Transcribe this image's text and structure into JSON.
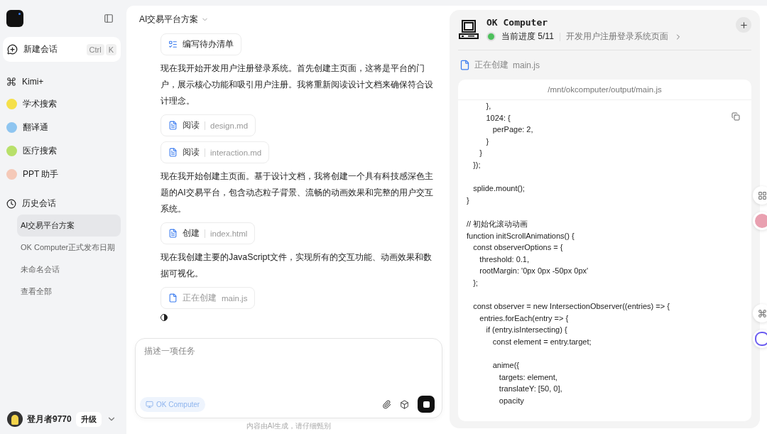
{
  "sidebar": {
    "new_chat": {
      "label": "新建会话",
      "keys": [
        "Ctrl",
        "K"
      ]
    },
    "items": [
      {
        "label": "Kimi+",
        "kind": "plain"
      },
      {
        "label": "学术搜索",
        "kind": "app",
        "color": "#f5e04a"
      },
      {
        "label": "翻译通",
        "kind": "app",
        "color": "#8ec5f0"
      },
      {
        "label": "医疗搜索",
        "kind": "app",
        "color": "#b8e06a"
      },
      {
        "label": "PPT 助手",
        "kind": "app",
        "color": "#f5c9b8"
      }
    ],
    "history": {
      "label": "历史会话",
      "items": [
        {
          "label": "AI交易平台方案",
          "selected": true
        },
        {
          "label": "OK Computer正式发布日期",
          "selected": false
        },
        {
          "label": "未命名会话",
          "selected": false
        }
      ],
      "view_all": "查看全部"
    },
    "user": {
      "name": "登月者9770",
      "badge": "升级"
    }
  },
  "chat": {
    "title": "AI交易平台方案",
    "messages": [
      {
        "kind": "todo",
        "action": "编写待办清单"
      },
      {
        "kind": "text",
        "text": "现在我开始开发用户注册登录系统。首先创建主页面，这将是平台的门户，展示核心功能和吸引用户注册。我将重新阅读设计文档来确保符合设计理念。"
      },
      {
        "kind": "file",
        "action": "阅读",
        "file": "design.md",
        "in_progress": false
      },
      {
        "kind": "file",
        "action": "阅读",
        "file": "interaction.md",
        "in_progress": false
      },
      {
        "kind": "text",
        "text": "现在我开始创建主页面。基于设计文档，我将创建一个具有科技感深色主题的AI交易平台，包含动态粒子背景、流畅的动画效果和完整的用户交互系统。"
      },
      {
        "kind": "file",
        "action": "创建",
        "file": "index.html",
        "in_progress": false
      },
      {
        "kind": "text",
        "text": "现在我创建主要的JavaScript文件，实现所有的交互功能、动画效果和数据可视化。"
      },
      {
        "kind": "file",
        "action": "正在创建",
        "file": "main.js",
        "in_progress": true
      }
    ],
    "input": {
      "placeholder": "描述一项任务",
      "mode": "OK Computer"
    },
    "disclaimer": "内容由AI生成，请仔细甄别"
  },
  "computer": {
    "title": "OK Computer",
    "progress": "当前进度 5/11",
    "step": "开发用户注册登录系统页面",
    "status": {
      "action": "正在创建",
      "file": "main.js"
    },
    "code": {
      "path": "/mnt/okcomputer/output/main.js",
      "blocks": [
        [
          "         },",
          "         1024: {",
          "            perPage: 2,",
          "         }",
          "      }",
          "   });"
        ],
        [
          "   splide.mount();",
          "}"
        ],
        [
          "// 初始化滚动动画",
          "function initScrollAnimations() {",
          "   const observerOptions = {",
          "      threshold: 0.1,",
          "      rootMargin: '0px 0px -50px 0px'",
          "   };"
        ],
        [
          "   const observer = new IntersectionObserver((entries) => {",
          "      entries.forEach(entry => {",
          "         if (entry.isIntersecting) {",
          "            const element = entry.target;"
        ],
        [
          "            anime({",
          "               targets: element,",
          "               translateY: [50, 0],",
          "               opacity"
        ]
      ]
    }
  }
}
